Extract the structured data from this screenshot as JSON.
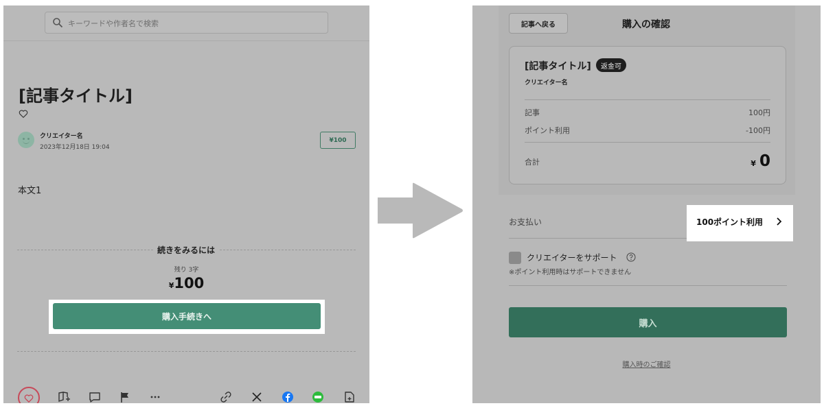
{
  "left": {
    "search": {
      "placeholder": "キーワードや作者名で検索"
    },
    "article": {
      "title": "[記事タイトル]",
      "creator": "クリエイター名",
      "date": "2023年12月18日 19:04",
      "price_badge": "¥100",
      "body": "本文1"
    },
    "paywall": {
      "heading": "続きをみるには",
      "remaining": "残り 3字",
      "currency": "¥",
      "price": "100",
      "buy_button": "購入手続きへ"
    },
    "bottom_icons": [
      "like-heart-icon",
      "add-to-magazine-icon",
      "comment-icon",
      "report-flag-icon",
      "more-icon",
      "copy-link-icon",
      "x-share-icon",
      "facebook-share-icon",
      "line-share-icon",
      "save-icon"
    ],
    "colors": {
      "buy_button": "#448e76",
      "like": "#c74a5a",
      "facebook": "#1877f2",
      "line": "#2dbb3c"
    }
  },
  "right": {
    "back_button": "記事へ戻る",
    "title": "購入の確認",
    "card": {
      "title": "[記事タイトル]",
      "refund_badge": "返金可",
      "creator": "クリエイター名",
      "rows": [
        {
          "label": "記事",
          "value": "100円"
        },
        {
          "label": "ポイント利用",
          "value": "-100円"
        }
      ],
      "total_label": "合計",
      "total_currency": "¥",
      "total_value": "0"
    },
    "payment": {
      "label": "お支払い",
      "value": "100ポイント利用"
    },
    "support": {
      "label": "クリエイターをサポート",
      "note": "※ポイント利用時はサポートできません"
    },
    "purchase_button": "購入",
    "confirm_link": "購入時のご確認",
    "colors": {
      "purchase_button": "#336f5a"
    }
  }
}
